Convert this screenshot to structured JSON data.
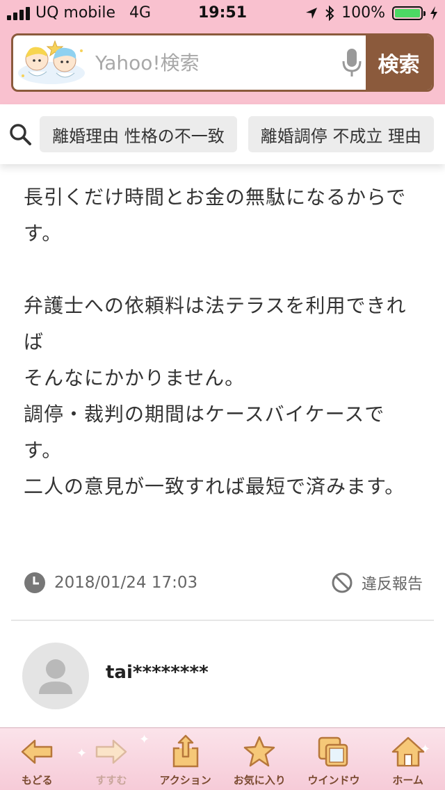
{
  "status_bar": {
    "carrier": "UQ mobile",
    "network": "4G",
    "time": "19:51",
    "battery": "100%"
  },
  "search": {
    "placeholder": "Yahoo!検索",
    "button_label": "検索"
  },
  "related_searches": [
    "離婚理由 性格の不一致",
    "離婚調停 不成立 理由"
  ],
  "answer": {
    "paragraph1": "長引くだけ時間とお金の無駄になるからで\nす。",
    "paragraph2": "弁護士への依頼料は法テラスを利用できれ\nば\nそんなにかかりません。\n調停・裁判の期間はケースバイケースで\nす。\n二人の意見が一致すれば最短で済みます。",
    "timestamp": "2018/01/24 17:03",
    "report_label": "違反報告"
  },
  "next_answer": {
    "username": "tai********"
  },
  "toolbar": {
    "back": "もどる",
    "forward": "すすむ",
    "action": "アクション",
    "favorites": "お気に入り",
    "window": "ウインドウ",
    "home": "ホーム"
  },
  "colors": {
    "header_pink": "#f9c1cf",
    "search_brown": "#8b5a3c",
    "battery_green": "#4cd964"
  }
}
